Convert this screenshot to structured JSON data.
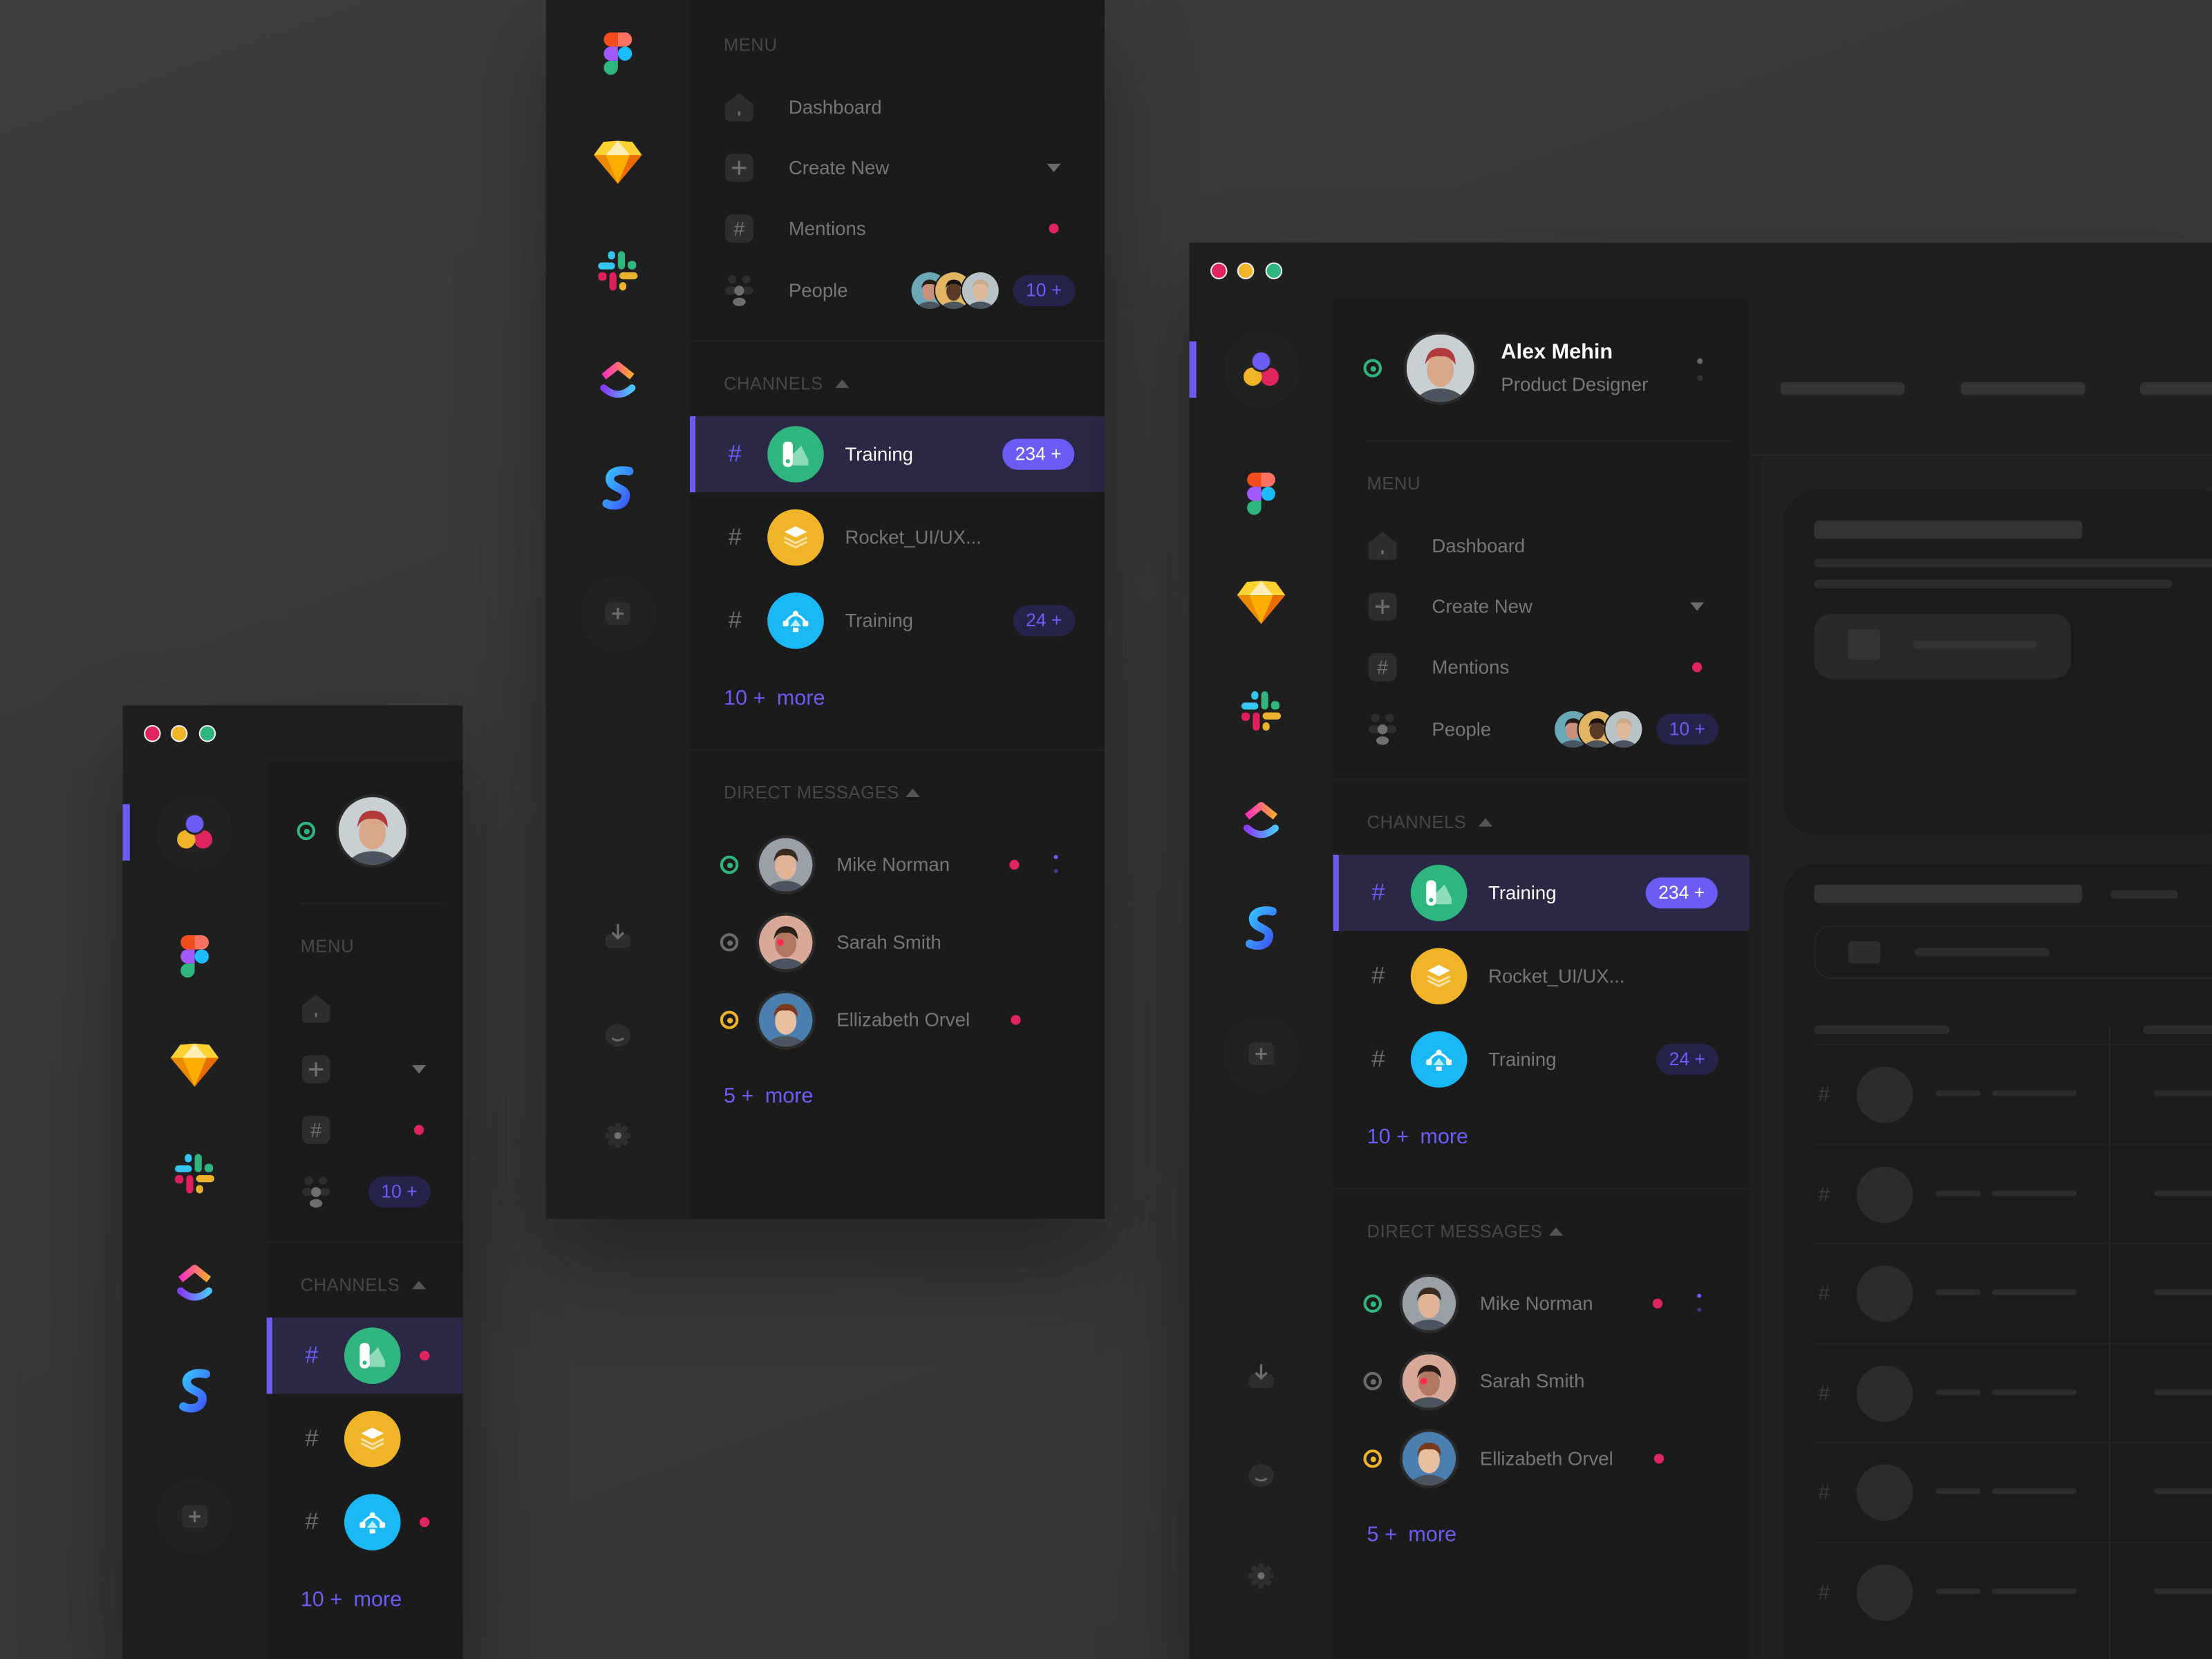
{
  "window_controls": {
    "close": "#e0245e",
    "minimize": "#f0b429",
    "maximize": "#2fb57e"
  },
  "colors": {
    "accent": "#6a5cf5",
    "active_row": "#2b2846",
    "unread": "#e0245e",
    "online": "#2fb57e",
    "away": "#f0b429",
    "offline": "#6b6b6b"
  },
  "app_rail": {
    "apps": [
      {
        "icon": "workspace-logo-icon"
      },
      {
        "icon": "figma-icon"
      },
      {
        "icon": "sketch-icon"
      },
      {
        "icon": "slack-icon"
      },
      {
        "icon": "clickup-icon"
      },
      {
        "icon": "s-app-icon"
      }
    ],
    "add_icon": "plus-icon",
    "bottom": [
      {
        "icon": "download-icon"
      },
      {
        "icon": "smile-icon"
      },
      {
        "icon": "settings-gear-icon"
      }
    ]
  },
  "user": {
    "name": "Alex Mehin",
    "role": "Product Designer",
    "status": "online"
  },
  "menu": {
    "title": "MENU",
    "items": [
      {
        "label": "Dashboard",
        "icon": "home-icon"
      },
      {
        "label": "Create New",
        "icon": "plus-icon",
        "dropdown": true
      },
      {
        "label": "Mentions",
        "icon": "hash-icon",
        "unread": true
      },
      {
        "label": "People",
        "icon": "people-icon",
        "badge": "10 +"
      }
    ]
  },
  "channels": {
    "title": "CHANNELS",
    "items": [
      {
        "label": "Training",
        "badge": "234 +",
        "color": "#2fb57e",
        "icon": "swatch-icon",
        "active": true,
        "unread": true
      },
      {
        "label": "Rocket_UI/UX...",
        "color": "#f0b429",
        "icon": "layers-icon"
      },
      {
        "label": "Training",
        "badge": "24 +",
        "color": "#1ab8f5",
        "icon": "vector-path-icon",
        "unread": true
      }
    ],
    "more_count": "10 +",
    "more_label": "more"
  },
  "direct_messages": {
    "title": "DIRECT MESSAGES",
    "items": [
      {
        "name": "Mike Norman",
        "status": "online",
        "unread": true
      },
      {
        "name": "Sarah Smith",
        "status": "offline"
      },
      {
        "name": "Ellizabeth Orvel",
        "status": "away",
        "unread": true
      }
    ],
    "more_count": "5 +",
    "more_label": "more"
  }
}
